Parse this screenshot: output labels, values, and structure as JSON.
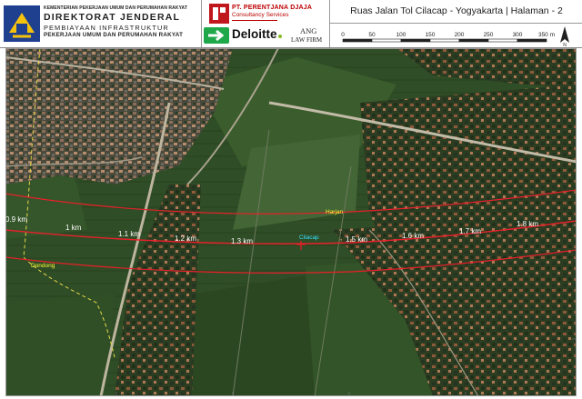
{
  "header": {
    "ministry_line1": "KEMENTERIAN PEKERJAAN UMUM DAN PERUMAHAN RAKYAT",
    "ministry_line2": "DIREKTORAT JENDERAL",
    "ministry_line3": "PEMBIAYAAN INFRASTRUKTUR",
    "ministry_line4": "PEKERJAAN UMUM DAN PERUMAHAN RAKYAT",
    "partner1_name": "PT. PERENTJANA DJAJA",
    "partner1_sub": "Consultancy Services",
    "partner2_name": "Deloitte",
    "partner3_name": "ANG",
    "partner3_sub": "LAW FIRM",
    "map_title": "Ruas Jalan Tol Cilacap - Yogyakarta | Halaman - 2"
  },
  "scale": {
    "ticks": [
      "0",
      "50",
      "100",
      "150",
      "200",
      "250",
      "300",
      "350 m"
    ],
    "north_symbol": "N"
  },
  "map": {
    "km_labels": [
      "0.9 km",
      "1 km",
      "1.1 km",
      "1.2 km",
      "1.3 km",
      "1.5 km",
      "1.6 km",
      "1.7 km",
      "1.8 km"
    ],
    "places": [
      {
        "name": "Harjan",
        "color": "#ffff33"
      },
      {
        "name": "Cilacap",
        "color": "#33e0ff"
      },
      {
        "name": "Dondong",
        "color": "#ffff33"
      }
    ],
    "route_color": "#e8202a",
    "boundary_color": "#e6d84a"
  }
}
